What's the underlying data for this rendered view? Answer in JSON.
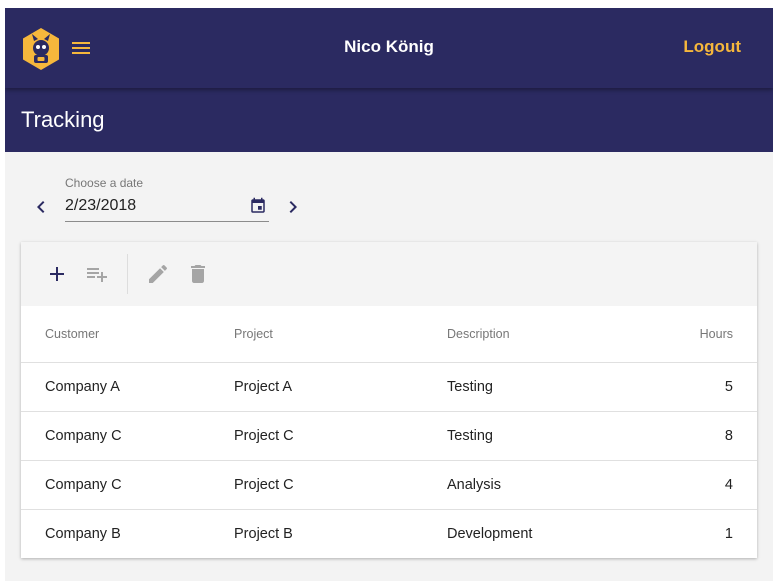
{
  "header": {
    "user_name": "Nico König",
    "logout_label": "Logout",
    "page_title": "Tracking"
  },
  "date_picker": {
    "label": "Choose a date",
    "value": "2/23/2018"
  },
  "table": {
    "columns": [
      "Customer",
      "Project",
      "Description",
      "Hours"
    ],
    "rows": [
      {
        "customer": "Company A",
        "project": "Project A",
        "description": "Testing",
        "hours": "5"
      },
      {
        "customer": "Company C",
        "project": "Project C",
        "description": "Testing",
        "hours": "8"
      },
      {
        "customer": "Company C",
        "project": "Project C",
        "description": "Analysis",
        "hours": "4"
      },
      {
        "customer": "Company B",
        "project": "Project B",
        "description": "Development",
        "hours": "1"
      }
    ]
  },
  "colors": {
    "primary": "#2b2a61",
    "accent": "#f6b73c",
    "background": "#f3f3f3"
  },
  "icons": [
    "logo-icon",
    "menu-icon",
    "chevron-left-icon",
    "calendar-icon",
    "chevron-right-icon",
    "add-icon",
    "playlist-add-icon",
    "edit-icon",
    "delete-icon"
  ]
}
